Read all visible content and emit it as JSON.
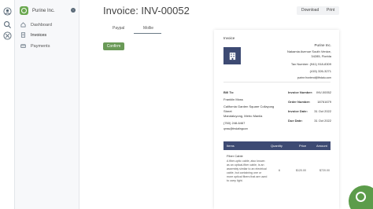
{
  "brand": {
    "name": "Purine Inc."
  },
  "nav": [
    {
      "label": "Dashboard",
      "icon": "dashboard-icon"
    },
    {
      "label": "Invoices",
      "icon": "invoices-icon"
    },
    {
      "label": "Payments",
      "icon": "payments-icon"
    }
  ],
  "header": {
    "title": "Invoice: INV-00052",
    "download": "Download",
    "print": "Print"
  },
  "tabs": [
    "Paypal",
    "Mollie"
  ],
  "confirm_label": "Confirm",
  "invoice": {
    "heading": "Invoice",
    "company": "Purine Inc.",
    "address1": "Nakamia Avenue South Venice,",
    "address2": "34285, Florida",
    "tax": "Tax Number: (941) 918-8309",
    "phone": "(415) 326-3271",
    "email": "purine.frontend@tfrdatu.com",
    "bill_to_label": "Bill To:",
    "bill_name": "Franklin Moss",
    "bill_addr1": "California Garden Square Collayung",
    "bill_addr2": "Street",
    "bill_addr3": "Mandaluyong, Metro Manila",
    "bill_phone": "(760) 248-6467",
    "bill_email": "qmss@fmdatingcom",
    "meta": [
      {
        "label": "Invoice Number:",
        "value": "INV-00052"
      },
      {
        "label": "Order Number:",
        "value": "18761679"
      },
      {
        "label": "Invoice Date:",
        "value": "31 Oct 2022"
      },
      {
        "label": "Due Date:",
        "value": "31 Oct 2022"
      }
    ],
    "columns": [
      "Items",
      "Quantity",
      "Price",
      "Amount"
    ],
    "item": {
      "name": "Fiber Cable",
      "desc": [
        "A fiber-optic cable, also known",
        "as an optical-fiber cable, is an",
        "assembly similar to an electrical",
        "cable, but containing one or",
        "more optical fibers that are used",
        "to carry light."
      ],
      "qty": "6",
      "price": "$120.00",
      "amount": "$720.00"
    }
  }
}
